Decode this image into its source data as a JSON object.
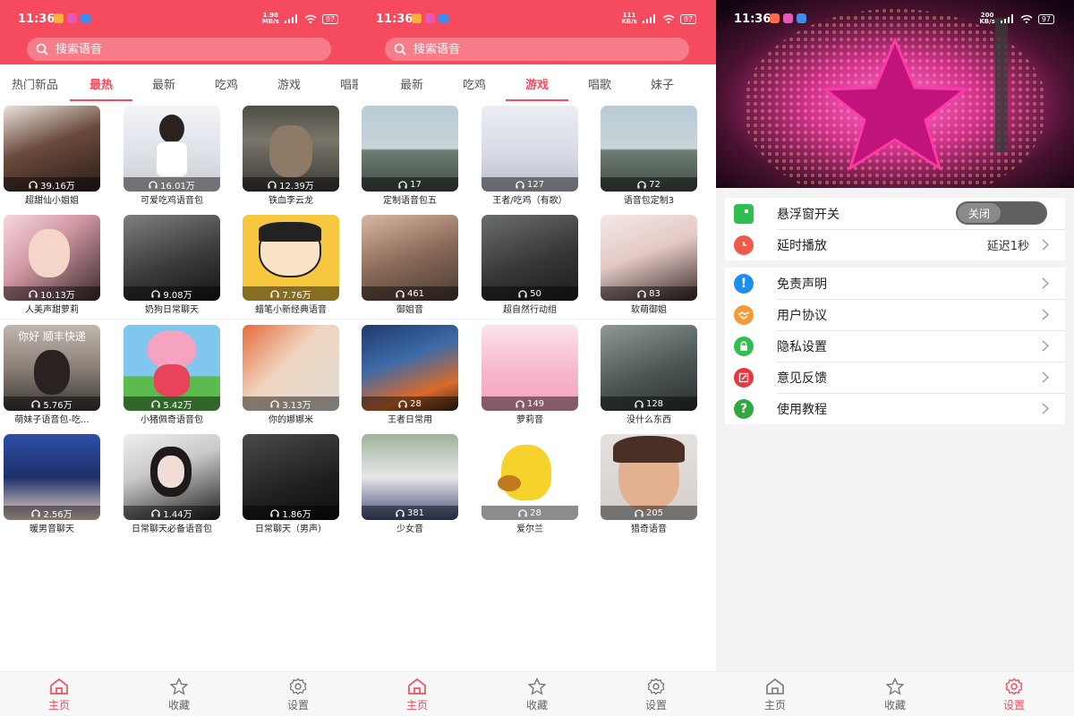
{
  "status": {
    "time": "11:36",
    "battery": "97",
    "screens": [
      {
        "speed_top": "1.98",
        "speed_bottom": "MB/s"
      },
      {
        "speed_top": "111",
        "speed_bottom": "KB/s"
      },
      {
        "speed_top": "200",
        "speed_bottom": "KB/s"
      }
    ]
  },
  "search": {
    "placeholder": "搜索语音"
  },
  "nav": {
    "home": "主页",
    "favorites": "收藏",
    "settings": "设置"
  },
  "colors": {
    "accent": "#f64b5e"
  },
  "screen1": {
    "tabs": [
      "热门新品",
      "最热",
      "最新",
      "吃鸡",
      "游戏",
      "唱歌"
    ],
    "active_tab": "最热",
    "cards": [
      {
        "title": "超甜仙小姐姐",
        "count": "39.16万"
      },
      {
        "title": "可爱吃鸡语音包",
        "count": "16.01万"
      },
      {
        "title": "铁血李云龙",
        "count": "12.39万"
      },
      {
        "title": "人美声甜萝莉",
        "count": "10.13万"
      },
      {
        "title": "奶狗日常聊天",
        "count": "9.08万"
      },
      {
        "title": "蜡笔小新经典语音",
        "count": "7.76万"
      },
      {
        "title": "萌妹子语音包-吃...",
        "count": "5.76万",
        "overlay": "你好 顺丰快递"
      },
      {
        "title": "小猪佩奇语音包",
        "count": "5.42万"
      },
      {
        "title": "你的娜娜米",
        "count": "3.13万"
      },
      {
        "title": "暖男音聊天",
        "count": "2.56万"
      },
      {
        "title": "日常聊天必备语音包",
        "count": "1.44万"
      },
      {
        "title": "日常聊天（男声）",
        "count": "1.86万"
      }
    ]
  },
  "screen2": {
    "tabs": [
      "最新",
      "吃鸡",
      "游戏",
      "唱歌",
      "妹子"
    ],
    "active_tab": "游戏",
    "cards": [
      {
        "title": "定制语音包五",
        "count": "17"
      },
      {
        "title": "王者/吃鸡（有歌）",
        "count": "127"
      },
      {
        "title": "语音包定制3",
        "count": "72"
      },
      {
        "title": "御姐音",
        "count": "461"
      },
      {
        "title": "超自然行动组",
        "count": "50"
      },
      {
        "title": "软萌御姐",
        "count": "83"
      },
      {
        "title": "王者日常用",
        "count": "28"
      },
      {
        "title": "萝莉音",
        "count": "149"
      },
      {
        "title": "没什么东西",
        "count": "128"
      },
      {
        "title": "少女音",
        "count": "381"
      },
      {
        "title": "爱尔兰",
        "count": "28"
      },
      {
        "title": "猎奇语音",
        "count": "205"
      }
    ]
  },
  "settings": {
    "floating_window": {
      "label": "悬浮窗开关",
      "toggle": "关闭"
    },
    "delay": {
      "label": "延时播放",
      "value": "延迟1秒"
    },
    "items": [
      "免责声明",
      "用户协议",
      "隐私设置",
      "意见反馈",
      "使用教程"
    ]
  }
}
